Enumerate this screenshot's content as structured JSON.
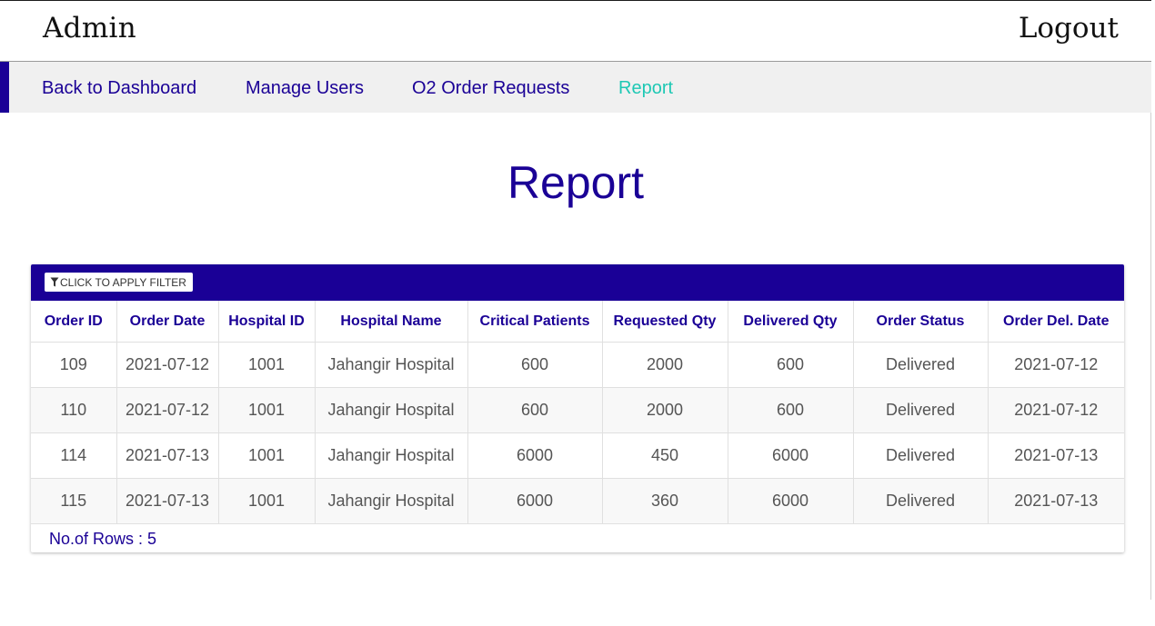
{
  "header": {
    "title": "Admin",
    "logout_label": "Logout"
  },
  "nav": {
    "items": [
      {
        "label": "Back to Dashboard",
        "active": false
      },
      {
        "label": "Manage Users",
        "active": false
      },
      {
        "label": "O2 Order Requests",
        "active": false
      },
      {
        "label": "Report",
        "active": true
      }
    ]
  },
  "page": {
    "title": "Report"
  },
  "report": {
    "filter_label": "CLICK TO APPLY FILTER",
    "columns": [
      "Order ID",
      "Order Date",
      "Hospital ID",
      "Hospital Name",
      "Critical Patients",
      "Requested Qty",
      "Delivered Qty",
      "Order Status",
      "Order Del. Date"
    ],
    "rows": [
      [
        "109",
        "2021-07-12",
        "1001",
        "Jahangir Hospital",
        "600",
        "2000",
        "600",
        "Delivered",
        "2021-07-12"
      ],
      [
        "110",
        "2021-07-12",
        "1001",
        "Jahangir Hospital",
        "600",
        "2000",
        "600",
        "Delivered",
        "2021-07-12"
      ],
      [
        "114",
        "2021-07-13",
        "1001",
        "Jahangir Hospital",
        "6000",
        "450",
        "6000",
        "Delivered",
        "2021-07-13"
      ],
      [
        "115",
        "2021-07-13",
        "1001",
        "Jahangir Hospital",
        "6000",
        "360",
        "6000",
        "Delivered",
        "2021-07-13"
      ]
    ],
    "rows_count_label": "No.of Rows : 5"
  },
  "colors": {
    "primary": "#1a0096",
    "active_nav": "#1ec8b4",
    "nav_bg": "#f0f0f0"
  }
}
